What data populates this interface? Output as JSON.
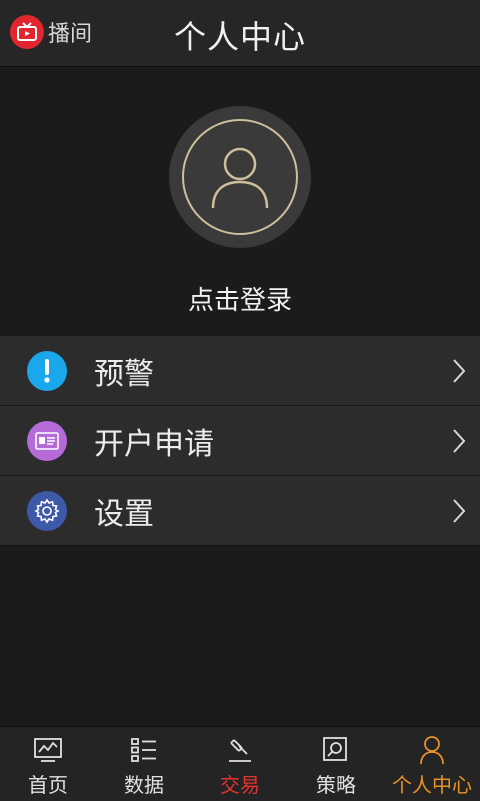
{
  "header": {
    "live_text": "播间",
    "title": "个人中心"
  },
  "profile": {
    "login_text": "点击登录"
  },
  "menu": {
    "items": [
      {
        "label": "预警",
        "icon": "alert-icon",
        "color": "#1aa7ec"
      },
      {
        "label": "开户申请",
        "icon": "id-card-icon",
        "color": "#b46bd8"
      },
      {
        "label": "设置",
        "icon": "gear-icon",
        "color": "#3d5aa8"
      }
    ]
  },
  "tabbar": {
    "items": [
      {
        "label": "首页",
        "icon": "chart-monitor-icon",
        "color": "#e0e0e0"
      },
      {
        "label": "数据",
        "icon": "list-icon",
        "color": "#e0e0e0"
      },
      {
        "label": "交易",
        "icon": "gavel-icon",
        "color": "#e5322d"
      },
      {
        "label": "策略",
        "icon": "magnifier-doc-icon",
        "color": "#e0e0e0"
      },
      {
        "label": "个人中心",
        "icon": "person-icon",
        "color": "#e8922a"
      }
    ]
  },
  "colors": {
    "accent_active": "#e8922a",
    "trade_red": "#e5322d",
    "live_red": "#e2262f"
  }
}
